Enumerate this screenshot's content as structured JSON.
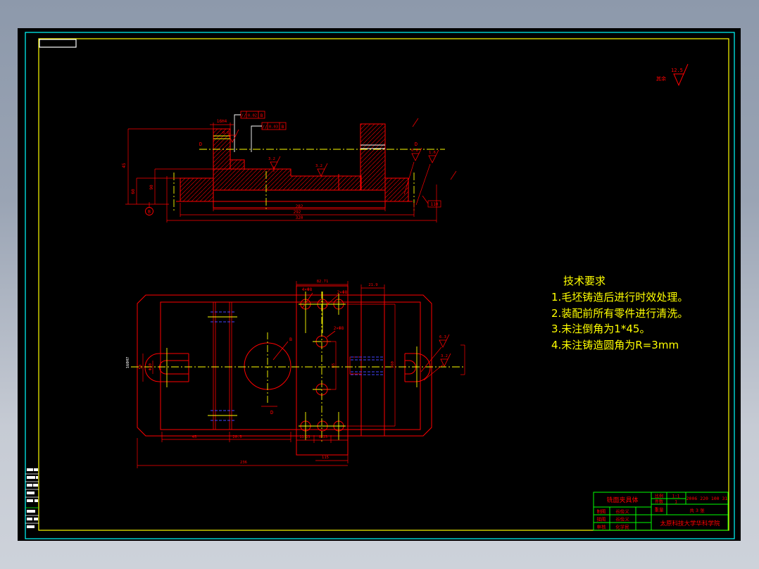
{
  "surface_note": {
    "prefix": "其余",
    "value": "12.5"
  },
  "tech": {
    "title": "技术要求",
    "item1": "1.毛坯铸造后进行时效处理。",
    "item2": "2.装配前所有零件进行清洗。",
    "item3": "3.未注倒角为1*45。",
    "item4": "4.未注铸造圆角为R=3mm"
  },
  "section": {
    "dim_boss": "16H4",
    "left_dims": [
      "45",
      "60",
      "90"
    ],
    "bottom_dims": [
      "282",
      "292",
      "320"
    ],
    "right_dim": "110",
    "tol1": {
      "sym": "//",
      "val": "0.02",
      "datum": "B"
    },
    "tol2": {
      "sym": "//",
      "val": "0.03",
      "datum": "B"
    },
    "rough": [
      "0.8",
      "3.2",
      "3.2",
      "0.8",
      "1.6"
    ],
    "datum": "B",
    "cut_label": "D"
  },
  "plan": {
    "dim_top": "82.71",
    "dim_top_right": "21.9",
    "bottom_dims": [
      "45",
      "20.5",
      "11.23",
      "8.23",
      "115",
      "236"
    ],
    "right_dim": "160",
    "left_dim": "160H7",
    "slot_dims": [
      "50",
      "Φ30"
    ],
    "mid_dim": "65",
    "callout1": "4×Φ8",
    "callout2": "2×Φ8",
    "callout3": "2×Φ8",
    "label_b": "B",
    "label_d": "D",
    "rough1": "6.3",
    "rough2": "3.2"
  },
  "title_block": {
    "part_name": "铣面夹具体",
    "scale_label": "比例",
    "scale": "1:1",
    "qty_label": "件数",
    "qty": "1",
    "weight_label": "重量",
    "sheet_info": "共 3 张",
    "drawing_no": "2006 220 100 31",
    "school": "太原科技大学华科学院",
    "rows": [
      {
        "label": "制图",
        "name": "谷俭义"
      },
      {
        "label": "描图",
        "name": "谷俭义"
      },
      {
        "label": "审核",
        "name": "化学民"
      }
    ]
  }
}
